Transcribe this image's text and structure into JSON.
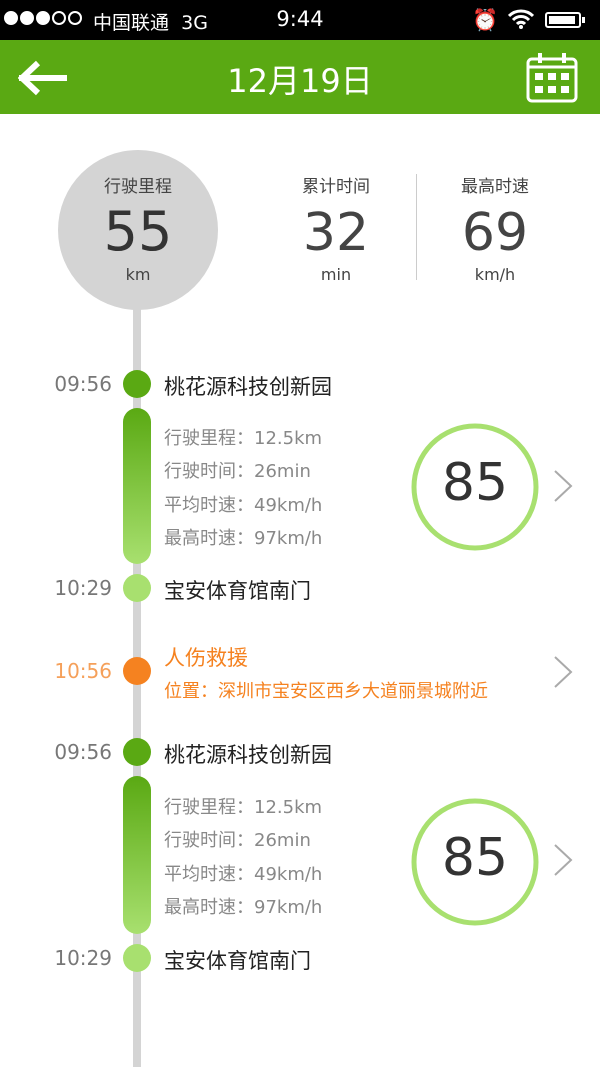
{
  "status_bar": {
    "carrier": "中国联通",
    "network": "3G",
    "time": "9:44"
  },
  "header": {
    "title": "12月19日"
  },
  "summary": {
    "distance": {
      "label": "行驶里程",
      "value": "55",
      "unit": "km"
    },
    "duration": {
      "label": "累计时间",
      "value": "32",
      "unit": "min"
    },
    "max_speed": {
      "label": "最高时速",
      "value": "69",
      "unit": "km/h"
    }
  },
  "timeline": [
    {
      "type": "trip",
      "start_time": "09:56",
      "start_place": "桃花源科技创新园",
      "details": [
        "行驶里程：12.5km",
        "行驶时间：26min",
        "平均时速：49km/h",
        "最高时速：97km/h"
      ],
      "score": "85",
      "score_fraction": 0.85,
      "end_time": "10:29",
      "end_place": "宝安体育馆南门"
    },
    {
      "type": "alert",
      "time": "10:56",
      "title": "人伤救援",
      "location": "位置：深圳市宝安区西乡大道丽景城附近"
    },
    {
      "type": "trip",
      "start_time": "09:56",
      "start_place": "桃花源科技创新园",
      "details": [
        "行驶里程：12.5km",
        "行驶时间：26min",
        "平均时速：49km/h",
        "最高时速：97km/h"
      ],
      "score": "85",
      "score_fraction": 0.85,
      "end_time": "10:29",
      "end_place": "宝安体育馆南门"
    }
  ],
  "colors": {
    "primary_green": "#5aa913",
    "light_green": "#a8e06f",
    "alert_orange": "#f58220"
  }
}
